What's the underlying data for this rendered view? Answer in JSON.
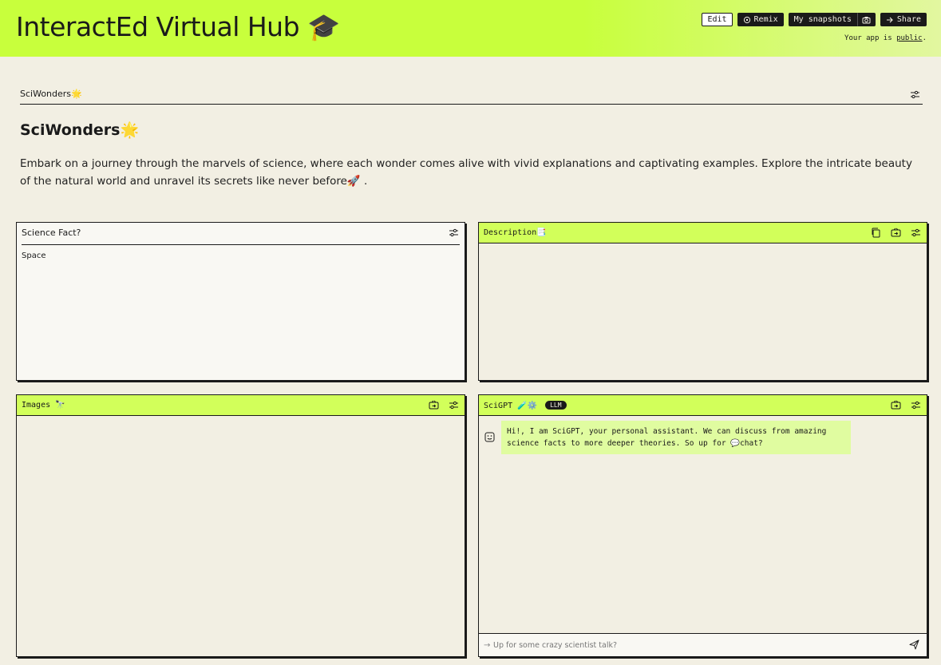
{
  "header": {
    "title": "InteractEd Virtual Hub 🎓",
    "buttons": {
      "edit": "Edit",
      "remix": "Remix",
      "snapshots": "My snapshots",
      "share": "Share"
    },
    "public_note_prefix": "Your app is",
    "public_note_link": "public",
    "public_note_suffix": "."
  },
  "tab": {
    "label": "SciWonders🌟"
  },
  "page": {
    "heading": "SciWonders🌟",
    "description": "Embark on a journey through the marvels of science, where each wonder comes alive with vivid explanations and captivating examples. Explore the intricate beauty of the natural world and unravel its secrets like never before🚀 ."
  },
  "panels": {
    "fact": {
      "title": "Science Fact?",
      "value": "Space"
    },
    "description": {
      "title": "Description📑"
    },
    "images": {
      "title": "Images 🔭"
    },
    "scigpt": {
      "title": "SciGPT 🧪⚙️",
      "badge": "LLM",
      "message": "Hi!, I am SciGPT, your personal assistant. We can discuss from amazing science facts to more deeper theories. So up for 💬chat?",
      "input_placeholder": "Up for some crazy scientist talk?"
    }
  },
  "colors": {
    "accent": "#c8ff3c",
    "background": "#f2efe3",
    "bubble": "#e0fca0",
    "ink": "#1a1a1a"
  }
}
